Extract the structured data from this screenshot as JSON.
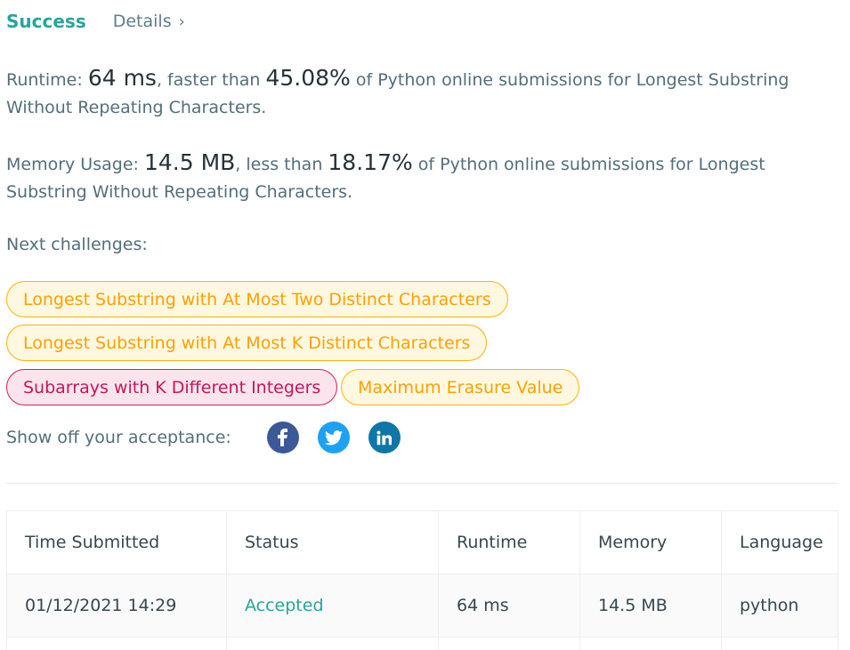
{
  "header": {
    "status": "Success",
    "details_label": "Details",
    "details_chevron": "›"
  },
  "runtime": {
    "label": "Runtime: ",
    "value": "64 ms",
    "mid": ", faster than ",
    "percent": "45.08%",
    "suffix": " of Python online submissions for Longest Substring Without Repeating Characters."
  },
  "memory": {
    "label": "Memory Usage: ",
    "value": "14.5 MB",
    "mid": ", less than ",
    "percent": "18.17%",
    "suffix": " of Python online submissions for Longest Substring Without Repeating Characters."
  },
  "next_challenges": {
    "label": "Next challenges:",
    "items": [
      {
        "label": "Longest Substring with At Most Two Distinct Characters",
        "difficulty": "medium"
      },
      {
        "label": "Longest Substring with At Most K Distinct Characters",
        "difficulty": "medium"
      },
      {
        "label": "Subarrays with K Different Integers",
        "difficulty": "hard"
      },
      {
        "label": "Maximum Erasure Value",
        "difficulty": "medium"
      }
    ]
  },
  "share": {
    "label": "Show off your acceptance:",
    "icons": [
      "facebook-icon",
      "twitter-icon",
      "linkedin-icon"
    ]
  },
  "submissions": {
    "headers": [
      "Time Submitted",
      "Status",
      "Runtime",
      "Memory",
      "Language"
    ],
    "rows": [
      [
        "01/12/2021 14:29",
        "Accepted",
        "64 ms",
        "14.5 MB",
        "python"
      ]
    ]
  },
  "colors": {
    "success": "#26a69a",
    "medium_chip": "#ffa000",
    "hard_chip": "#c2185b",
    "facebook": "#3b5998",
    "twitter": "#1da1f2",
    "linkedin": "#0e76a8"
  }
}
